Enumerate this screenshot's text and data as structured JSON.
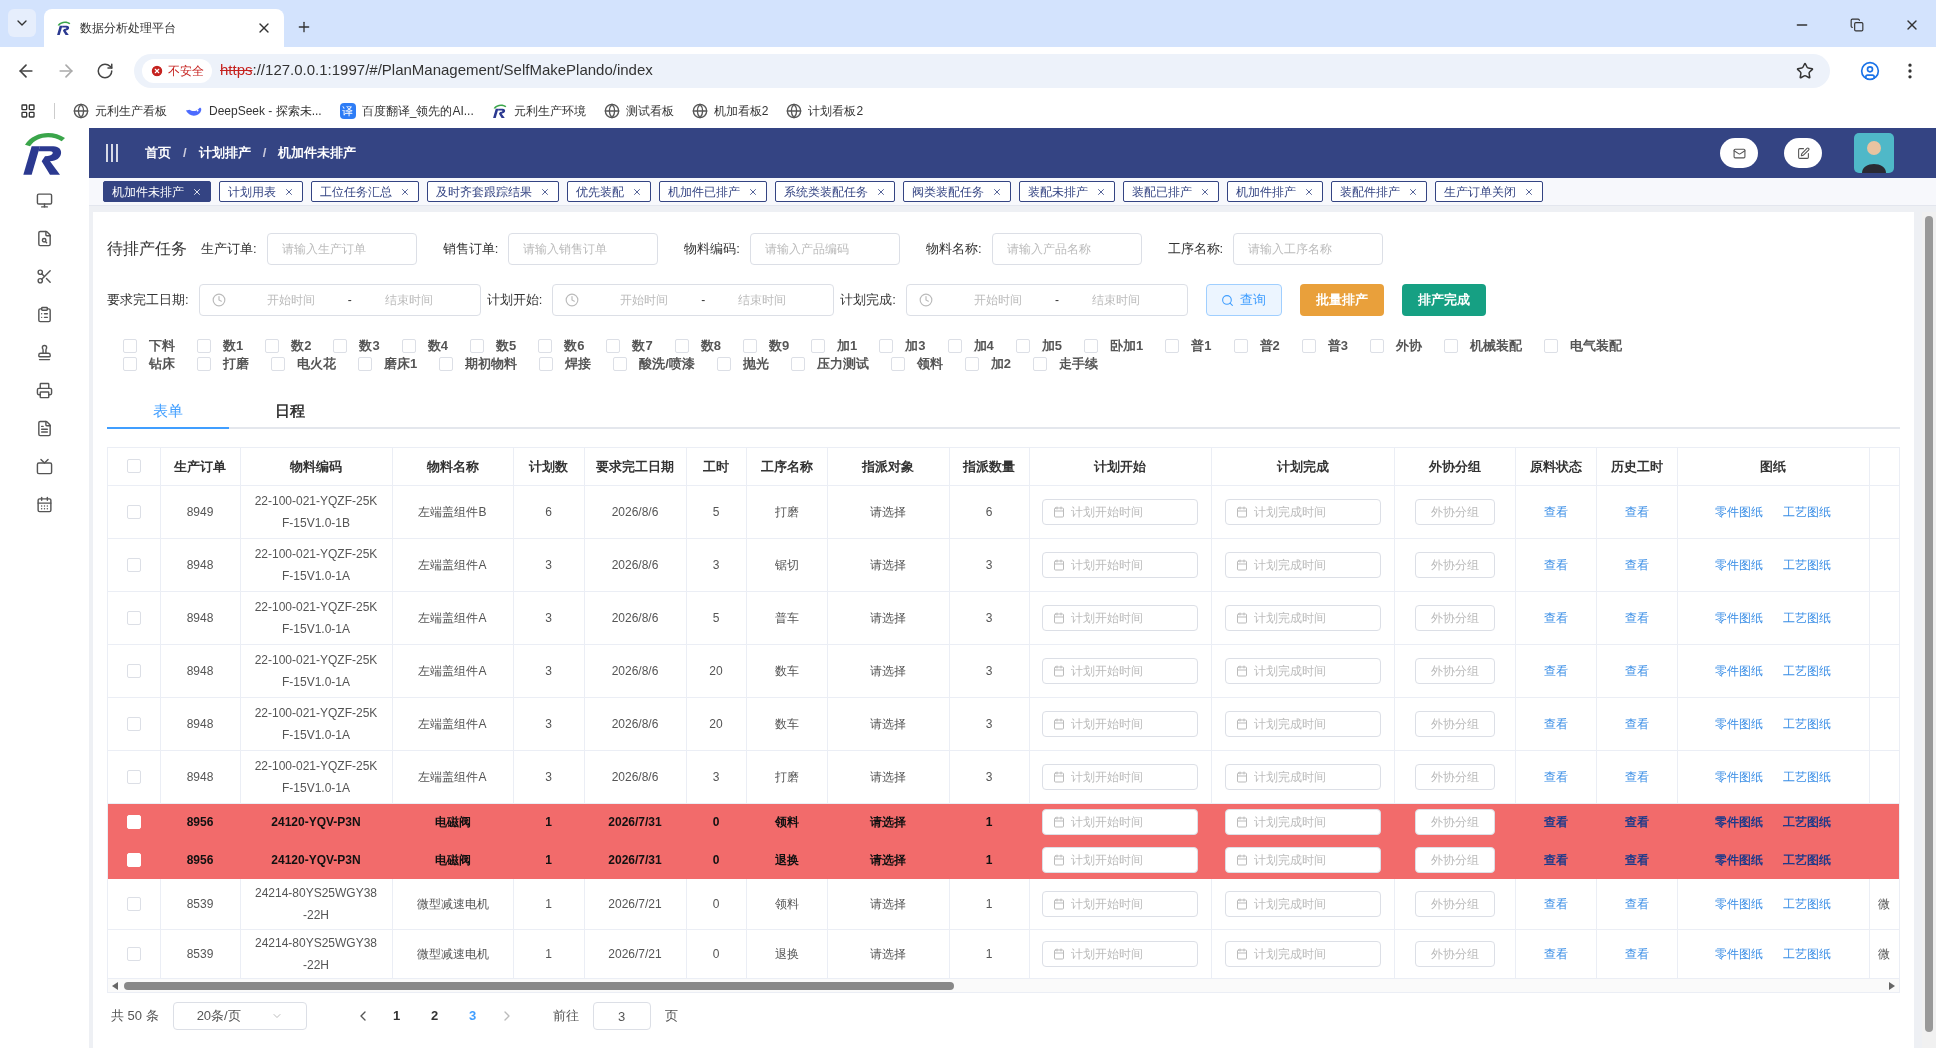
{
  "browser": {
    "tab_title": "数据分析处理平台",
    "security_label": "不安全",
    "url_scheme": "https",
    "url_rest": "://127.0.0.1:1997/#/PlanManagement/SelfMakePlando/index",
    "bookmarks": [
      {
        "kind": "globe",
        "label": "元利生产看板"
      },
      {
        "kind": "whale",
        "label": "DeepSeek - 探索未..."
      },
      {
        "kind": "translate",
        "badge": "译",
        "label": "百度翻译_领先的AI..."
      },
      {
        "kind": "logo",
        "label": "元利生产环境"
      },
      {
        "kind": "globe",
        "label": "测试看板"
      },
      {
        "kind": "globe",
        "label": "机加看板2"
      },
      {
        "kind": "globe",
        "label": "计划看板2"
      }
    ]
  },
  "header": {
    "breadcrumb": [
      "首页",
      "计划排产",
      "机加件未排产"
    ],
    "separator": "/"
  },
  "tags": [
    {
      "label": "机加件未排产",
      "selected": true
    },
    {
      "label": "计划用表",
      "selected": false
    },
    {
      "label": "工位任务汇总",
      "selected": false
    },
    {
      "label": "及时齐套跟踪结果",
      "selected": false
    },
    {
      "label": "优先装配",
      "selected": false
    },
    {
      "label": "机加件已排产",
      "selected": false
    },
    {
      "label": "系统类装配任务",
      "selected": false
    },
    {
      "label": "阀类装配任务",
      "selected": false
    },
    {
      "label": "装配未排产",
      "selected": false
    },
    {
      "label": "装配已排产",
      "selected": false
    },
    {
      "label": "机加件排产",
      "selected": false
    },
    {
      "label": "装配件排产",
      "selected": false
    },
    {
      "label": "生产订单关闭",
      "selected": false
    }
  ],
  "filters": {
    "title": "待排产任务",
    "fields": [
      {
        "label": "生产订单:",
        "placeholder": "请输入生产订单"
      },
      {
        "label": "销售订单:",
        "placeholder": "请输入销售订单"
      },
      {
        "label": "物料编码:",
        "placeholder": "请输入产品编码"
      },
      {
        "label": "物料名称:",
        "placeholder": "请输入产品名称"
      },
      {
        "label": "工序名称:",
        "placeholder": "请输入工序名称"
      }
    ],
    "date_ranges": [
      {
        "label": "要求完工日期:",
        "start_placeholder": "开始时间",
        "separator": "-",
        "end_placeholder": "结束时间"
      },
      {
        "label": "计划开始:",
        "start_placeholder": "开始时间",
        "separator": "-",
        "end_placeholder": "结束时间"
      },
      {
        "label": "计划完成:",
        "start_placeholder": "开始时间",
        "separator": "-",
        "end_placeholder": "结束时间"
      }
    ],
    "buttons": [
      {
        "kind": "query",
        "label": "查询"
      },
      {
        "kind": "warning",
        "label": "批量排产"
      },
      {
        "kind": "success",
        "label": "排产完成"
      }
    ],
    "checkbox_rows": [
      [
        {
          "label": "下料",
          "checked": false
        },
        {
          "label": "数1",
          "checked": false
        },
        {
          "label": "数2",
          "checked": false
        },
        {
          "label": "数3",
          "checked": false
        },
        {
          "label": "数4",
          "checked": false
        },
        {
          "label": "数5",
          "checked": false
        },
        {
          "label": "数6",
          "checked": false
        },
        {
          "label": "数7",
          "checked": false
        },
        {
          "label": "数8",
          "checked": false
        },
        {
          "label": "数9",
          "checked": false
        },
        {
          "label": "加1",
          "checked": false
        },
        {
          "label": "加3",
          "checked": false
        },
        {
          "label": "加4",
          "checked": false
        },
        {
          "label": "加5",
          "checked": false
        },
        {
          "label": "卧加1",
          "checked": false
        },
        {
          "label": "普1",
          "checked": false
        },
        {
          "label": "普2",
          "checked": false
        },
        {
          "label": "普3",
          "checked": false
        },
        {
          "label": "外协",
          "checked": false
        },
        {
          "label": "机械装配",
          "checked": false
        },
        {
          "label": "电气装配",
          "checked": false
        }
      ],
      [
        {
          "label": "钻床",
          "checked": false
        },
        {
          "label": "打磨",
          "checked": false
        },
        {
          "label": "电火花",
          "checked": false
        },
        {
          "label": "磨床1",
          "checked": false
        },
        {
          "label": "期初物料",
          "checked": false
        },
        {
          "label": "焊接",
          "checked": false
        },
        {
          "label": "酸洗/喷漆",
          "checked": false
        },
        {
          "label": "抛光",
          "checked": false
        },
        {
          "label": "压力测试",
          "checked": false
        },
        {
          "label": "领料",
          "checked": false
        },
        {
          "label": "加2",
          "checked": false
        },
        {
          "label": "走手续",
          "checked": false
        }
      ]
    ]
  },
  "view_tabs": [
    {
      "label": "表单",
      "selected": true
    },
    {
      "label": "日程",
      "selected": false
    }
  ],
  "table": {
    "select_all_checked": false,
    "columns": [
      "生产订单",
      "物料编码",
      "物料名称",
      "计划数",
      "要求完工日期",
      "工时",
      "工序名称",
      "指派对象",
      "指派数量",
      "计划开始",
      "计划完成",
      "外协分组",
      "原料状态",
      "历史工时",
      "图纸"
    ],
    "rows": [
      {
        "highlighted": false,
        "checked": false,
        "order": "8949",
        "code": "22-100-021-YQZF-25KF-15V1.0-1B",
        "name": "左端盖组件B",
        "plan_qty": "6",
        "due_date": "2026/8/6",
        "hours": "5",
        "process": "打磨",
        "assignee": "请选择",
        "assign_qty": "6",
        "start_placeholder": "计划开始时间",
        "end_placeholder": "计划完成时间",
        "group_placeholder": "外协分组",
        "material_status": "查看",
        "history": "查看",
        "drawings": [
          "零件图纸",
          "工艺图纸"
        ]
      },
      {
        "highlighted": false,
        "checked": false,
        "order": "8948",
        "code": "22-100-021-YQZF-25KF-15V1.0-1A",
        "name": "左端盖组件A",
        "plan_qty": "3",
        "due_date": "2026/8/6",
        "hours": "3",
        "process": "锯切",
        "assignee": "请选择",
        "assign_qty": "3",
        "start_placeholder": "计划开始时间",
        "end_placeholder": "计划完成时间",
        "group_placeholder": "外协分组",
        "material_status": "查看",
        "history": "查看",
        "drawings": [
          "零件图纸",
          "工艺图纸"
        ]
      },
      {
        "highlighted": false,
        "checked": false,
        "order": "8948",
        "code": "22-100-021-YQZF-25KF-15V1.0-1A",
        "name": "左端盖组件A",
        "plan_qty": "3",
        "due_date": "2026/8/6",
        "hours": "5",
        "process": "普车",
        "assignee": "请选择",
        "assign_qty": "3",
        "start_placeholder": "计划开始时间",
        "end_placeholder": "计划完成时间",
        "group_placeholder": "外协分组",
        "material_status": "查看",
        "history": "查看",
        "drawings": [
          "零件图纸",
          "工艺图纸"
        ]
      },
      {
        "highlighted": false,
        "checked": false,
        "order": "8948",
        "code": "22-100-021-YQZF-25KF-15V1.0-1A",
        "name": "左端盖组件A",
        "plan_qty": "3",
        "due_date": "2026/8/6",
        "hours": "20",
        "process": "数车",
        "assignee": "请选择",
        "assign_qty": "3",
        "start_placeholder": "计划开始时间",
        "end_placeholder": "计划完成时间",
        "group_placeholder": "外协分组",
        "material_status": "查看",
        "history": "查看",
        "drawings": [
          "零件图纸",
          "工艺图纸"
        ]
      },
      {
        "highlighted": false,
        "checked": false,
        "order": "8948",
        "code": "22-100-021-YQZF-25KF-15V1.0-1A",
        "name": "左端盖组件A",
        "plan_qty": "3",
        "due_date": "2026/8/6",
        "hours": "20",
        "process": "数车",
        "assignee": "请选择",
        "assign_qty": "3",
        "start_placeholder": "计划开始时间",
        "end_placeholder": "计划完成时间",
        "group_placeholder": "外协分组",
        "material_status": "查看",
        "history": "查看",
        "drawings": [
          "零件图纸",
          "工艺图纸"
        ]
      },
      {
        "highlighted": false,
        "checked": false,
        "order": "8948",
        "code": "22-100-021-YQZF-25KF-15V1.0-1A",
        "name": "左端盖组件A",
        "plan_qty": "3",
        "due_date": "2026/8/6",
        "hours": "3",
        "process": "打磨",
        "assignee": "请选择",
        "assign_qty": "3",
        "start_placeholder": "计划开始时间",
        "end_placeholder": "计划完成时间",
        "group_placeholder": "外协分组",
        "material_status": "查看",
        "history": "查看",
        "drawings": [
          "零件图纸",
          "工艺图纸"
        ]
      },
      {
        "highlighted": true,
        "checked": false,
        "order": "8956",
        "code": "24120-YQV-P3N",
        "name": "电磁阀",
        "plan_qty": "1",
        "due_date": "2026/7/31",
        "hours": "0",
        "process": "领料",
        "assignee": "请选择",
        "assign_qty": "1",
        "start_placeholder": "计划开始时间",
        "end_placeholder": "计划完成时间",
        "group_placeholder": "外协分组",
        "material_status": "查看",
        "history": "查看",
        "drawings": [
          "零件图纸",
          "工艺图纸"
        ]
      },
      {
        "highlighted": true,
        "checked": false,
        "order": "8956",
        "code": "24120-YQV-P3N",
        "name": "电磁阀",
        "plan_qty": "1",
        "due_date": "2026/7/31",
        "hours": "0",
        "process": "退换",
        "assignee": "请选择",
        "assign_qty": "1",
        "start_placeholder": "计划开始时间",
        "end_placeholder": "计划完成时间",
        "group_placeholder": "外协分组",
        "material_status": "查看",
        "history": "查看",
        "drawings": [
          "零件图纸",
          "工艺图纸"
        ]
      },
      {
        "highlighted": false,
        "checked": false,
        "order": "8539",
        "code": "24214-80YS25WGY38-22H",
        "name": "微型减速电机",
        "plan_qty": "1",
        "due_date": "2026/7/21",
        "hours": "0",
        "process": "领料",
        "assignee": "请选择",
        "assign_qty": "1",
        "start_placeholder": "计划开始时间",
        "end_placeholder": "计划完成时间",
        "group_placeholder": "外协分组",
        "material_status": "查看",
        "history": "查看",
        "drawings": [
          "零件图纸",
          "工艺图纸"
        ],
        "column_17": "微"
      },
      {
        "highlighted": false,
        "checked": false,
        "order": "8539",
        "code": "24214-80YS25WGY38-22H",
        "name": "微型减速电机",
        "plan_qty": "1",
        "due_date": "2026/7/21",
        "hours": "0",
        "process": "退换",
        "assignee": "请选择",
        "assign_qty": "1",
        "start_placeholder": "计划开始时间",
        "end_placeholder": "计划完成时间",
        "group_placeholder": "外协分组",
        "material_status": "查看",
        "history": "查看",
        "drawings": [
          "零件图纸",
          "工艺图纸"
        ],
        "column_17": "微"
      }
    ]
  },
  "pagination": {
    "total": "共 50 条",
    "page_size": "20条/页",
    "pages": [
      {
        "label": "1",
        "selected": false
      },
      {
        "label": "2",
        "selected": false
      },
      {
        "label": "3",
        "selected": true
      }
    ],
    "goto_label": "前往",
    "goto_value": "3",
    "page_suffix": "页"
  }
}
